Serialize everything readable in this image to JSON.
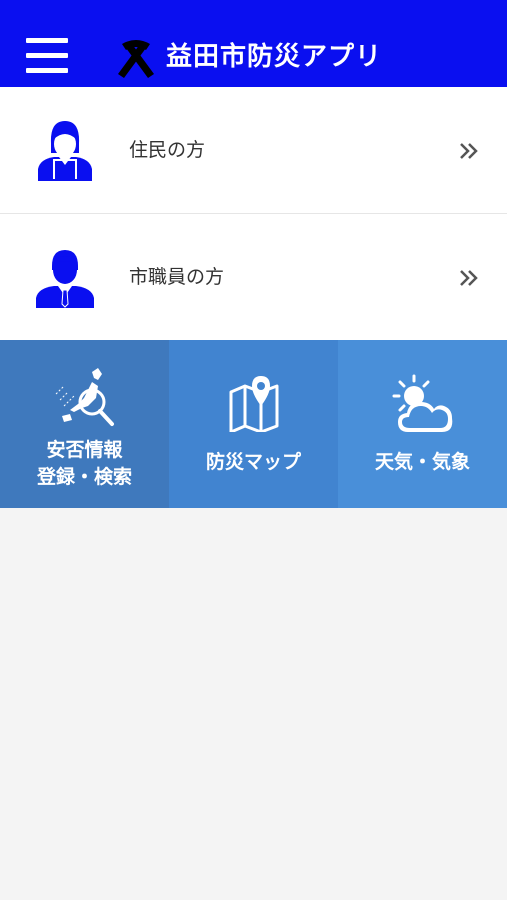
{
  "header": {
    "title": "益田市防災アプリ",
    "menu_icon": "hamburger-menu-icon",
    "logo_icon": "ribbon-icon",
    "color": "#0a0ff0"
  },
  "user_types": [
    {
      "label": "住民の方",
      "icon": "female-user-icon"
    },
    {
      "label": "市職員の方",
      "icon": "male-staff-icon"
    }
  ],
  "chevron_icon": "double-chevron-right-icon",
  "tiles": [
    {
      "line1": "安否情報",
      "line2": "登録・検索",
      "icon": "japan-map-search-icon",
      "color": "#3f79bd"
    },
    {
      "line1": "防災マップ",
      "icon": "map-pin-icon",
      "color": "#4184d0"
    },
    {
      "line1": "天気・気象",
      "icon": "sun-cloud-icon",
      "color": "#498fd9"
    }
  ]
}
